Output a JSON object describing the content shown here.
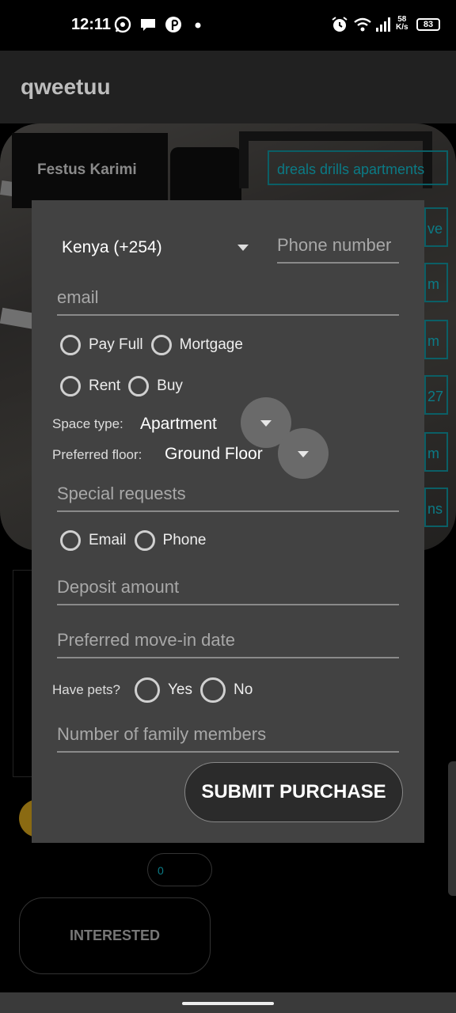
{
  "status_bar": {
    "time": "12:11",
    "net_speed_value": "58",
    "net_speed_unit": "K/s",
    "battery": "83",
    "icons": [
      "whatsapp-icon",
      "chat-icon",
      "pinterest-icon",
      "dot-icon",
      "alarm-icon",
      "wifi-icon",
      "signal-icon",
      "battery-icon"
    ]
  },
  "app_bar": {
    "title": "qweetuu"
  },
  "background": {
    "user_name": "Festus Karimi",
    "link_label": "dreals drills apartments",
    "side_fragments": [
      "ve",
      "m",
      "m",
      "27",
      "m",
      "ns"
    ],
    "count_value": "0",
    "interested_label": "INTERESTED"
  },
  "form": {
    "country_code": "Kenya (+254)",
    "phone_placeholder": "Phone number",
    "email_placeholder": "email",
    "payment_options": [
      "Pay Full",
      "Mortgage"
    ],
    "transaction_options": [
      "Rent",
      "Buy"
    ],
    "space_type_label": "Space type:",
    "space_type_value": "Apartment",
    "preferred_floor_label": "Preferred floor:",
    "preferred_floor_value": "Ground Floor",
    "special_requests_placeholder": "Special requests",
    "contact_options": [
      "Email",
      "Phone"
    ],
    "deposit_placeholder": "Deposit amount",
    "move_in_placeholder": "Preferred move-in date",
    "pets_label": "Have pets?",
    "pets_options": [
      "Yes",
      "No"
    ],
    "family_placeholder": "Number of family members",
    "submit_label": "SUBMIT PURCHASE"
  }
}
